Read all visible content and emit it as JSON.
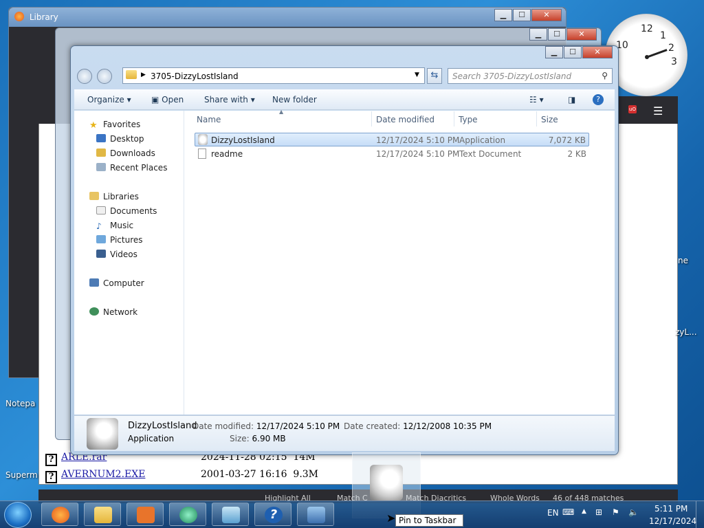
{
  "library": {
    "title": "Library",
    "min": "▁",
    "max": "☐",
    "close": "✕"
  },
  "background_files": [
    {
      "name": "ARLE.rar",
      "date": "2024-11-28 02:15",
      "size": "14M"
    },
    {
      "name": "AVERNUM2.EXE",
      "date": "2001-03-27 16:16",
      "size": "9.3M"
    }
  ],
  "findbar": {
    "highlight": "Highlight All",
    "match_case": "Match C",
    "diacritics": "Match Diacritics",
    "whole_words": "Whole Words",
    "matches": "46 of 448 matches"
  },
  "explorer": {
    "path": "3705-DizzyLostIsland",
    "search_placeholder": "Search 3705-DizzyLostIsland",
    "toolbar": {
      "organize": "Organize",
      "open": "Open",
      "share_with": "Share with",
      "new_folder": "New folder"
    },
    "nav": {
      "favorites": "Favorites",
      "desktop": "Desktop",
      "downloads": "Downloads",
      "recent": "Recent Places",
      "libraries": "Libraries",
      "documents": "Documents",
      "music": "Music",
      "pictures": "Pictures",
      "videos": "Videos",
      "computer": "Computer",
      "network": "Network"
    },
    "columns": {
      "name": "Name",
      "date": "Date modified",
      "type": "Type",
      "size": "Size"
    },
    "files": [
      {
        "name": "DizzyLostIsland",
        "date": "12/17/2024 5:10 PM",
        "type": "Application",
        "size": "7,072 KB"
      },
      {
        "name": "readme",
        "date": "12/17/2024 5:10 PM",
        "type": "Text Document",
        "size": "2 KB"
      }
    ],
    "details": {
      "name": "DizzyLostIsland",
      "kind": "Application",
      "modified_label": "Date modified:",
      "modified": "12/17/2024 5:10 PM",
      "created_label": "Date created:",
      "created": "12/12/2008 10:35 PM",
      "size_label": "Size:",
      "size": "6.90 MB"
    }
  },
  "clock_numbers": [
    "12",
    "1",
    "2",
    "3",
    "10"
  ],
  "desktop": {
    "notepad": "Notepa",
    "superm": "Superm",
    "side1": "ne",
    "side2": "zyL..."
  },
  "tooltip": "Pin to Taskbar",
  "tray": {
    "lang": "EN",
    "time": "5:11 PM",
    "date": "12/17/2024"
  }
}
